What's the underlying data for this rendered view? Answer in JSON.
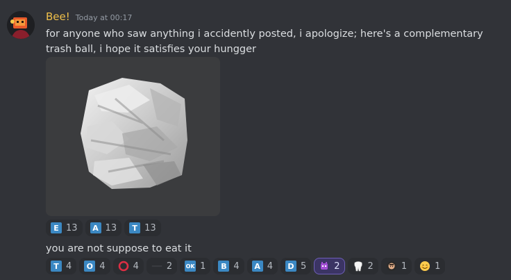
{
  "message": {
    "username": "Bee!",
    "username_color": "#f0c04a",
    "timestamp": "Today at 00:17",
    "text": "for anyone who saw anything i accidently posted, i apologize; here's a complementary trash ball, i hope it satisfies your hungger",
    "attachment": {
      "type": "image"
    },
    "reactions": [
      {
        "glyph": "E",
        "style": "blue-letter",
        "count": "13"
      },
      {
        "glyph": "A",
        "style": "blue-letter",
        "count": "13"
      },
      {
        "glyph": "T",
        "style": "blue-letter",
        "count": "13"
      }
    ]
  },
  "reply": {
    "text": "you are not suppose to eat it",
    "reactions": [
      {
        "glyph": "T",
        "style": "blue-letter",
        "count": "4"
      },
      {
        "glyph": "O",
        "style": "blue-letter",
        "count": "4"
      },
      {
        "glyph": "⭕",
        "style": "red-ring",
        "count": "4"
      },
      {
        "glyph": "—",
        "style": "dash",
        "count": "2"
      },
      {
        "glyph": "OK",
        "style": "blue-letter",
        "count": "1"
      },
      {
        "glyph": "B",
        "style": "blue-letter",
        "count": "4"
      },
      {
        "glyph": "A",
        "style": "blue-letter",
        "count": "4"
      },
      {
        "glyph": "D",
        "style": "blue-letter",
        "count": "5"
      },
      {
        "glyph": "👾",
        "style": "custom-purple",
        "count": "2",
        "active": true
      },
      {
        "glyph": "🦷",
        "style": "unicode",
        "count": "2"
      },
      {
        "glyph": "🧑",
        "style": "custom-face",
        "count": "1"
      },
      {
        "glyph": "😊",
        "style": "unicode",
        "count": "1"
      }
    ]
  }
}
